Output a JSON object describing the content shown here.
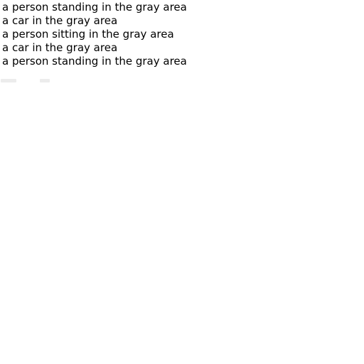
{
  "captions": [
    "a person standing in the gray area",
    "a car in the gray area",
    "a person sitting in the gray area",
    "a car in the gray area",
    "a person standing in the gray area"
  ]
}
